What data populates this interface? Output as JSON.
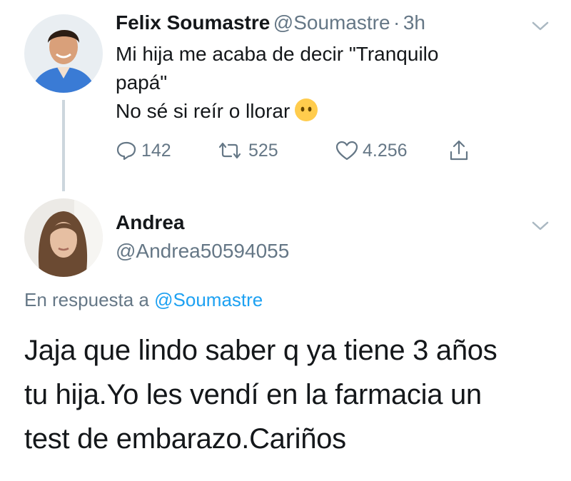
{
  "original_tweet": {
    "name": "Felix Soumastre",
    "handle": "@Soumastre",
    "separator": "·",
    "time": "3h",
    "line1": "Mi hija me acaba de decir \"Tranquilo",
    "line2": "papá\"",
    "line3": "No sé si reír o llorar",
    "emoji": "face-without-mouth-emoji",
    "reply_count": "142",
    "retweet_count": "525",
    "like_count": "4.256"
  },
  "reply_tweet": {
    "name": "Andrea",
    "handle": "@Andrea50594055",
    "replying_prefix": "En respuesta a",
    "replying_to": "@Soumastre",
    "line1": "Jaja que lindo saber q ya tiene 3 años",
    "line2": "tu hija.Yo les vendí en la farmacia un",
    "line3": "test de embarazo.Cariños"
  },
  "colors": {
    "text": "#14171a",
    "secondary": "#657786",
    "accent": "#1da1f2",
    "thread_line": "#ccd6dd"
  }
}
